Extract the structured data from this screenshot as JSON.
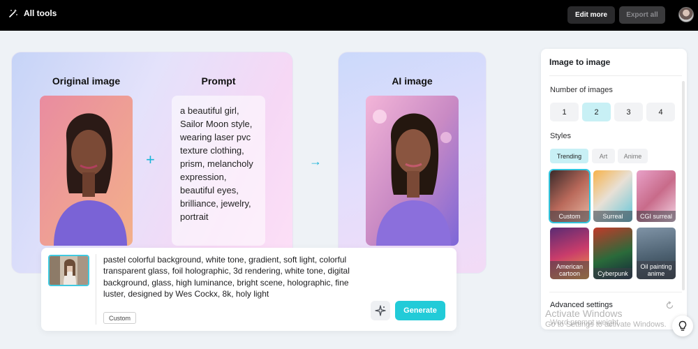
{
  "topbar": {
    "all_tools_label": "All tools",
    "edit_more_label": "Edit more",
    "export_all_label": "Export all"
  },
  "workspace": {
    "original_title": "Original image",
    "prompt_title": "Prompt",
    "ai_title": "AI image",
    "prompt_text": "a beautiful girl, Sailor Moon style, wearing laser pvc texture clothing, prism, melancholy expression, beautiful eyes, brilliance, jewelry, portrait"
  },
  "input": {
    "prompt_value": "pastel colorful background, white tone, gradient, soft light, colorful transparent glass, foil holographic, 3d rendering, white tone, digital background, glass, high luminance, bright scene, holographic, fine luster, designed by Wes Cockx, 8k, holy light",
    "style_tag": "Custom",
    "generate_label": "Generate"
  },
  "panel": {
    "title": "Image to image",
    "number_label": "Number of images",
    "numbers": [
      "1",
      "2",
      "3",
      "4"
    ],
    "selected_number": "2",
    "styles_label": "Styles",
    "style_tabs": [
      "Trending",
      "Art",
      "Anime"
    ],
    "active_tab": "Trending",
    "style_cards": [
      {
        "name": "Custom",
        "selected": true
      },
      {
        "name": "Surreal",
        "selected": false
      },
      {
        "name": "CGI surreal",
        "selected": false
      },
      {
        "name": "American cartoon",
        "selected": false
      },
      {
        "name": "Cyberpunk",
        "selected": false
      },
      {
        "name": "Oil painting anime",
        "selected": false
      }
    ],
    "advanced_label": "Advanced settings",
    "word_prompt_label": "Word prompt weight"
  },
  "watermark": {
    "line1": "Activate Windows",
    "line2": "Go to Settings to activate Windows."
  },
  "colors": {
    "accent": "#22cbd8",
    "selected_bg": "#c8f0f5",
    "topbar": "#000000"
  }
}
